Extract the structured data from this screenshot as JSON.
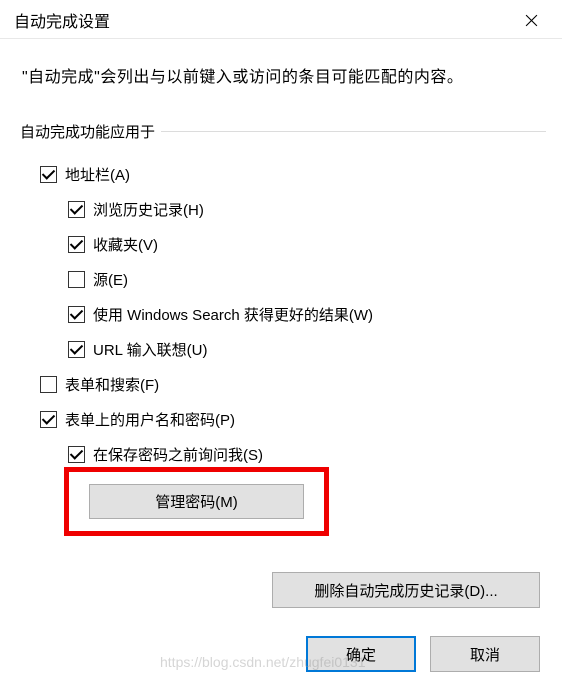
{
  "window": {
    "title": "自动完成设置"
  },
  "description": "\"自动完成\"会列出与以前键入或访问的条目可能匹配的内容。",
  "group": {
    "label": "自动完成功能应用于",
    "items": {
      "address_bar": {
        "label": "地址栏(A)",
        "checked": true
      },
      "browsing_history": {
        "label": "浏览历史记录(H)",
        "checked": true
      },
      "favorites": {
        "label": "收藏夹(V)",
        "checked": true
      },
      "feeds": {
        "label": "源(E)",
        "checked": false
      },
      "windows_search": {
        "label": "使用 Windows Search 获得更好的结果(W)",
        "checked": true
      },
      "url_suggestions": {
        "label": "URL 输入联想(U)",
        "checked": true
      },
      "forms_searches": {
        "label": "表单和搜索(F)",
        "checked": false
      },
      "forms_passwords": {
        "label": "表单上的用户名和密码(P)",
        "checked": true
      },
      "ask_before_save": {
        "label": "在保存密码之前询问我(S)",
        "checked": true
      }
    }
  },
  "buttons": {
    "manage_passwords": "管理密码(M)",
    "delete_history": "删除自动完成历史记录(D)...",
    "ok": "确定",
    "cancel": "取消"
  },
  "watermark": "https://blog.csdn.net/zhugfei0131"
}
